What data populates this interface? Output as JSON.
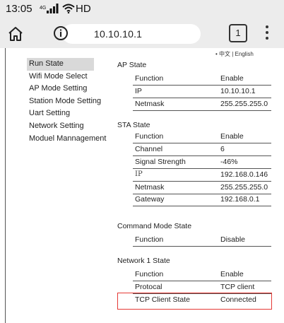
{
  "status_bar": {
    "time": "13:05",
    "signal_type": "4G",
    "network": "HD"
  },
  "address_bar": {
    "url": "10.10.10.1",
    "tab_count": "1"
  },
  "language": "• 中文 | English",
  "nav": [
    {
      "label": "Run State",
      "active": true
    },
    {
      "label": "Wifi Mode Select"
    },
    {
      "label": "AP Mode Setting"
    },
    {
      "label": "Station Mode Setting"
    },
    {
      "label": "Uart Setting"
    },
    {
      "label": "Network Setting"
    },
    {
      "label": "Moduel Mannagement"
    }
  ],
  "sections": {
    "ap": {
      "title": "AP State",
      "rows": [
        {
          "k": "Function",
          "v": "Enable"
        },
        {
          "k": "IP",
          "v": "10.10.10.1"
        },
        {
          "k": "Netmask",
          "v": "255.255.255.0"
        }
      ]
    },
    "sta": {
      "title": "STA State",
      "rows": [
        {
          "k": "Function",
          "v": "Enable"
        },
        {
          "k": "Channel",
          "v": "6"
        },
        {
          "k": "Signal Strength",
          "v": "-46%"
        },
        {
          "k": "IP",
          "v": "192.168.0.146"
        },
        {
          "k": "Netmask",
          "v": "255.255.255.0"
        },
        {
          "k": "Gateway",
          "v": "192.168.0.1"
        }
      ]
    },
    "cmd": {
      "title": "Command Mode State",
      "rows": [
        {
          "k": "Function",
          "v": "Disable"
        }
      ]
    },
    "net1": {
      "title": "Network 1 State",
      "rows": [
        {
          "k": "Function",
          "v": "Enable"
        },
        {
          "k": "Protocal",
          "v": "TCP client"
        },
        {
          "k": "TCP Client State",
          "v": "Connected"
        }
      ]
    }
  },
  "colors": {
    "highlight": "#e53935",
    "chrome": "#ececec",
    "active_nav": "#d9d9d9"
  }
}
